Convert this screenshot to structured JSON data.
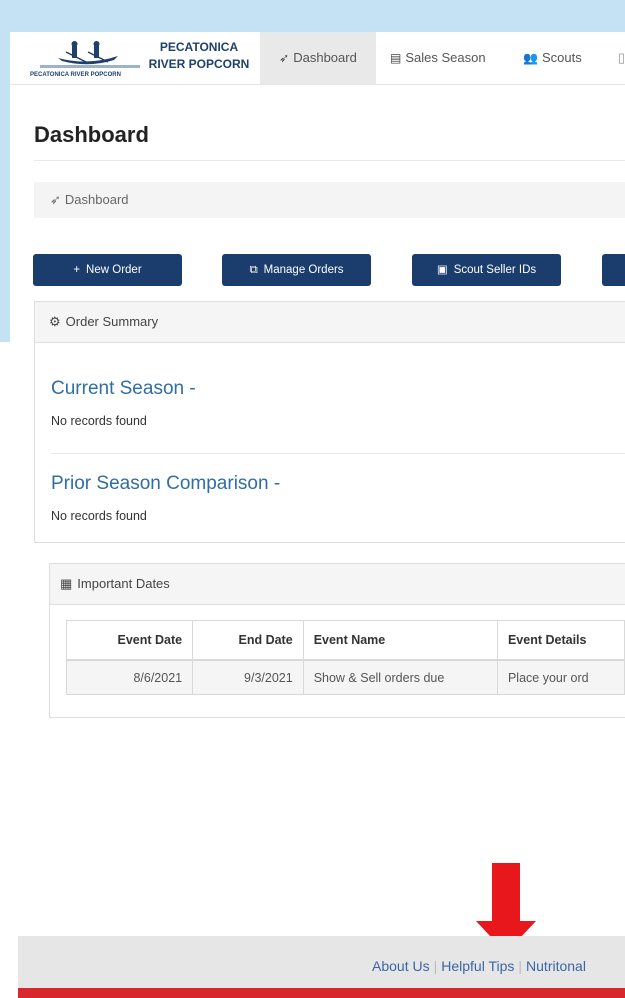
{
  "brand": {
    "logo_subtext": "PECATONICA RIVER POPCORN",
    "name_line1": "PECATONICA",
    "name_line2": "RIVER POPCORN"
  },
  "nav": {
    "items": [
      {
        "label": "Dashboard",
        "icon": "rocket-icon",
        "active": true
      },
      {
        "label": "Sales Season",
        "icon": "file-icon",
        "active": false
      },
      {
        "label": "Scouts",
        "icon": "users-icon",
        "active": false
      }
    ]
  },
  "page": {
    "title": "Dashboard",
    "breadcrumb": "Dashboard"
  },
  "actions": [
    {
      "label": "New Order",
      "icon": "plus-icon"
    },
    {
      "label": "Manage Orders",
      "icon": "copy-icon"
    },
    {
      "label": "Scout Seller IDs",
      "icon": "id-card-icon"
    }
  ],
  "order_summary": {
    "heading": "Order Summary",
    "current_season_title": "Current Season -",
    "current_season_empty": "No records found",
    "prior_season_title": "Prior Season Comparison -",
    "prior_season_empty": "No records found"
  },
  "important_dates": {
    "heading": "Important Dates",
    "columns": [
      "Event Date",
      "End Date",
      "Event Name",
      "Event Details"
    ],
    "rows": [
      {
        "event_date": "8/6/2021",
        "end_date": "9/3/2021",
        "event_name": "Show & Sell orders due",
        "event_details": "Place your ord"
      }
    ]
  },
  "footer": {
    "links": [
      "About Us",
      "Helpful Tips",
      "Nutritonal"
    ]
  },
  "colors": {
    "primary": "#1a3d6e",
    "link": "#2f6ea3",
    "annotation_arrow": "#e8171b",
    "footer_bar": "#d8272d",
    "background_blue": "#c5e2f5"
  }
}
